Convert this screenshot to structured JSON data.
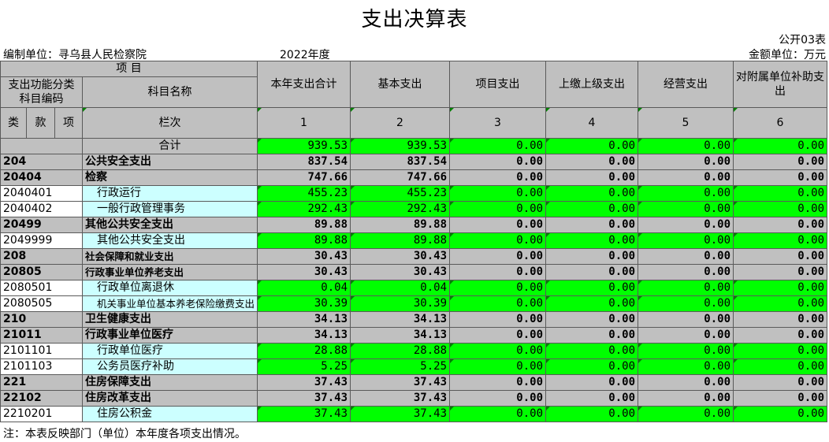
{
  "title": "支出决算表",
  "form_no": "公开03表",
  "unit_label": "编制单位：寻乌县人民检察院",
  "year": "2022年度",
  "money_unit": "金额单位：万元",
  "header": {
    "item": "项    目",
    "code_col": "支出功能分类科目编码",
    "name_col": "科目名称",
    "columns": [
      "本年支出合计",
      "基本支出",
      "项目支出",
      "上缴上级支出",
      "经营支出",
      "对附属单位补助支出"
    ],
    "lei": "类",
    "kuan": "款",
    "xiang": "项",
    "lanci": "栏次",
    "col_numbers": [
      "1",
      "2",
      "3",
      "4",
      "5",
      "6"
    ]
  },
  "total": {
    "name": "合计",
    "values": [
      "939.53",
      "939.53",
      "0.00",
      "0.00",
      "0.00",
      "0.00"
    ]
  },
  "rows": [
    {
      "code": "204",
      "name": "公共安全支出",
      "level": "major",
      "values": [
        "837.54",
        "837.54",
        "0.00",
        "0.00",
        "0.00",
        "0.00"
      ]
    },
    {
      "code": "20404",
      "name": "检察",
      "level": "major",
      "values": [
        "747.66",
        "747.66",
        "0.00",
        "0.00",
        "0.00",
        "0.00"
      ]
    },
    {
      "code": "2040401",
      "name": "行政运行",
      "level": "minor",
      "values": [
        "455.23",
        "455.23",
        "0.00",
        "0.00",
        "0.00",
        "0.00"
      ]
    },
    {
      "code": "2040402",
      "name": "一般行政管理事务",
      "level": "minor",
      "values": [
        "292.43",
        "292.43",
        "0.00",
        "0.00",
        "0.00",
        "0.00"
      ]
    },
    {
      "code": "20499",
      "name": "其他公共安全支出",
      "level": "major",
      "values": [
        "89.88",
        "89.88",
        "0.00",
        "0.00",
        "0.00",
        "0.00"
      ]
    },
    {
      "code": "2049999",
      "name": "其他公共安全支出",
      "level": "minor",
      "values": [
        "89.88",
        "89.88",
        "0.00",
        "0.00",
        "0.00",
        "0.00"
      ]
    },
    {
      "code": "208",
      "name": "社会保障和就业支出",
      "level": "major",
      "values": [
        "30.43",
        "30.43",
        "0.00",
        "0.00",
        "0.00",
        "0.00"
      ]
    },
    {
      "code": "20805",
      "name": "行政事业单位养老支出",
      "level": "major",
      "values": [
        "30.43",
        "30.43",
        "0.00",
        "0.00",
        "0.00",
        "0.00"
      ]
    },
    {
      "code": "2080501",
      "name": "行政单位离退休",
      "level": "minor",
      "values": [
        "0.04",
        "0.04",
        "0.00",
        "0.00",
        "0.00",
        "0.00"
      ]
    },
    {
      "code": "2080505",
      "name": "机关事业单位基本养老保险缴费支出",
      "level": "minor",
      "values": [
        "30.39",
        "30.39",
        "0.00",
        "0.00",
        "0.00",
        "0.00"
      ]
    },
    {
      "code": "210",
      "name": "卫生健康支出",
      "level": "major",
      "values": [
        "34.13",
        "34.13",
        "0.00",
        "0.00",
        "0.00",
        "0.00"
      ]
    },
    {
      "code": "21011",
      "name": "行政事业单位医疗",
      "level": "major",
      "values": [
        "34.13",
        "34.13",
        "0.00",
        "0.00",
        "0.00",
        "0.00"
      ]
    },
    {
      "code": "2101101",
      "name": "行政单位医疗",
      "level": "minor",
      "values": [
        "28.88",
        "28.88",
        "0.00",
        "0.00",
        "0.00",
        "0.00"
      ]
    },
    {
      "code": "2101103",
      "name": "公务员医疗补助",
      "level": "minor",
      "values": [
        "5.25",
        "5.25",
        "0.00",
        "0.00",
        "0.00",
        "0.00"
      ]
    },
    {
      "code": "221",
      "name": "住房保障支出",
      "level": "major",
      "values": [
        "37.43",
        "37.43",
        "0.00",
        "0.00",
        "0.00",
        "0.00"
      ]
    },
    {
      "code": "22102",
      "name": "住房改革支出",
      "level": "major",
      "values": [
        "37.43",
        "37.43",
        "0.00",
        "0.00",
        "0.00",
        "0.00"
      ]
    },
    {
      "code": "2210201",
      "name": "住房公积金",
      "level": "minor",
      "values": [
        "37.43",
        "37.43",
        "0.00",
        "0.00",
        "0.00",
        "0.00"
      ]
    }
  ],
  "note": "注：本表反映部门（单位）本年度各项支出情况。",
  "colors": {
    "header_grey": "#c0c0c0",
    "value_green": "#00ff00",
    "name_cyan": "#ccffff"
  }
}
